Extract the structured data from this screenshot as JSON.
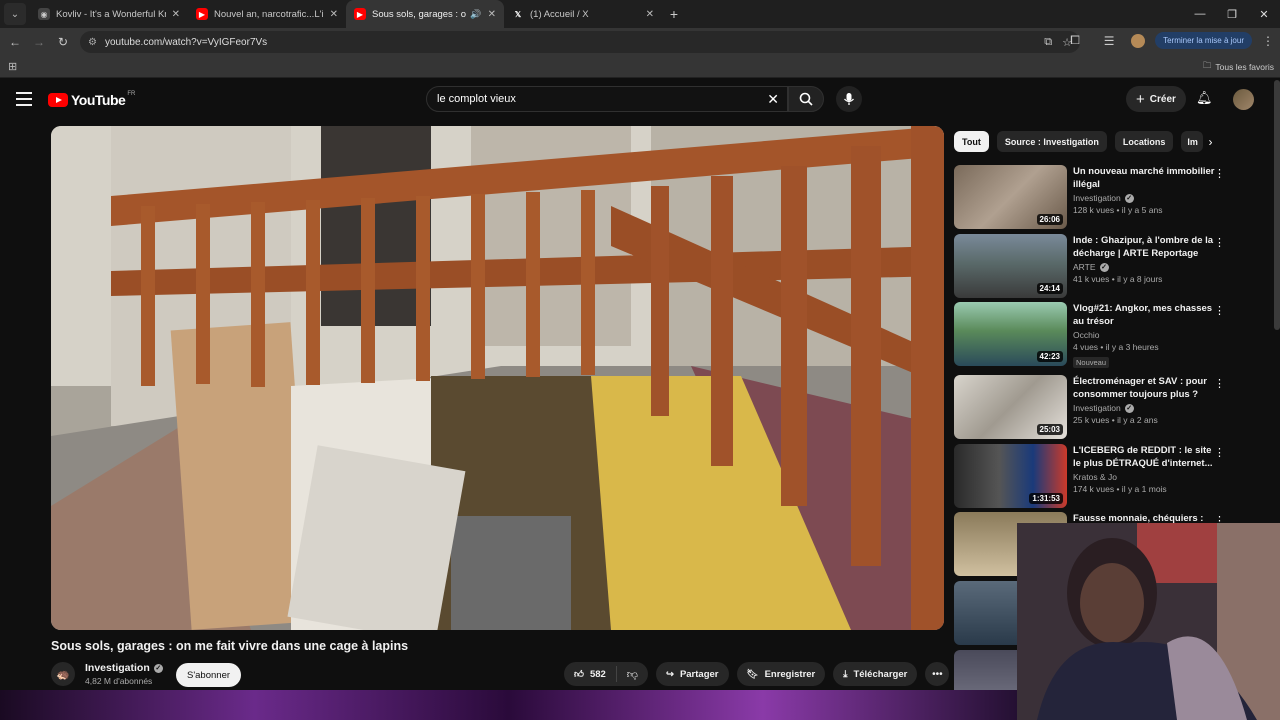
{
  "browser": {
    "tabs": [
      {
        "title": "Kovliv - It's a Wonderful Knife (",
        "icon": "globe-icon",
        "active": false
      },
      {
        "title": "Nouvel an, narcotrafic...L'interv",
        "icon": "youtube-icon",
        "active": false
      },
      {
        "title": "Sous sols, garages : on me",
        "icon": "youtube-icon",
        "active": true,
        "audio": true
      },
      {
        "title": "(1) Accueil / X",
        "icon": "x-icon",
        "active": false
      }
    ],
    "url": "youtube.com/watch?v=VyIGFeor7Vs",
    "update_button": "Terminer la mise à jour",
    "bookmarks_all": "Tous les favoris"
  },
  "youtube": {
    "logo_text": "YouTube",
    "country_code": "FR",
    "search_query": "le complot vieux",
    "create_label": "Créer"
  },
  "video": {
    "title": "Sous sols, garages : on me fait vivre dans une cage à lapins",
    "channel": "Investigation",
    "subscribers": "4,82 M d'abonnés",
    "subscribe_label": "S'abonner",
    "likes": "582",
    "share_label": "Partager",
    "save_label": "Enregistrer",
    "download_label": "Télécharger"
  },
  "chips": [
    "Tout",
    "Source : Investigation",
    "Locations",
    "Im"
  ],
  "recommendations": [
    {
      "title": "Un nouveau marché immobilier illégal",
      "channel": "Investigation",
      "verified": true,
      "meta": "128 k vues • il y a 5 ans",
      "duration": "26:06",
      "thumb_color": "#8a7a6a"
    },
    {
      "title": "Inde : Ghazipur, à l'ombre de la décharge | ARTE Reportage",
      "channel": "ARTE",
      "verified": true,
      "meta": "41 k vues • il y a 8 jours",
      "duration": "24:14",
      "thumb_color": "#6a7a8a"
    },
    {
      "title": "Vlog#21: Angkor, mes chasses au trésor",
      "channel": "Occhio",
      "verified": false,
      "meta": "4 vues • il y a 3 heures",
      "duration": "42:23",
      "badge": "Nouveau",
      "thumb_color": "#4a7a5a"
    },
    {
      "title": "Électroménager et SAV : pour consommer toujours plus ?",
      "channel": "Investigation",
      "verified": true,
      "meta": "25 k vues • il y a 2 ans",
      "duration": "25:03",
      "thumb_color": "#b0aaa2"
    },
    {
      "title": "L'ICEBERG de REDDIT : le site le plus DÉTRAQUÉ d'internet...",
      "channel": "Kratos & Jo",
      "verified": false,
      "meta": "174 k vues • il y a 1 mois",
      "duration": "1:31:53",
      "thumb_color": "#3a3a3a"
    },
    {
      "title": "Fausse monnaie, chéquiers :",
      "channel": "",
      "verified": false,
      "meta": "",
      "duration": "",
      "thumb_color": "#8a7a5a"
    }
  ]
}
